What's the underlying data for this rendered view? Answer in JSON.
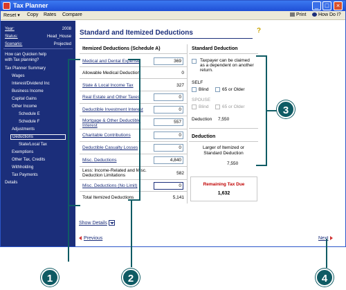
{
  "window": {
    "title": "Tax Planner",
    "minimize": "_",
    "maximize": "□",
    "close": "×"
  },
  "menu": {
    "reset": "Reset",
    "copy": "Copy",
    "rates": "Rates",
    "compare": "Compare",
    "print": "Print",
    "how_do_i": "How Do I?"
  },
  "sidebar": {
    "year_label": "Year:",
    "year_value": "2008",
    "status_label": "Status:",
    "status_value": "Head_House",
    "scenario_label": "Scenario:",
    "scenario_value": "Projected",
    "help_line1": "How can Quicken help",
    "help_line2": "with Tax planning?",
    "nav": [
      "Tax Planner Summary",
      "Wages",
      "Interest/Dividend Inc",
      "Business Income",
      "Capital Gains",
      "Other Income",
      "Schedule E",
      "Schedule F",
      "Adjustments",
      "Deductions",
      "State/Local Tax",
      "Exemptions",
      "Other Tax, Credits",
      "Withholding",
      "Tax Payments",
      "Details"
    ]
  },
  "main": {
    "title": "Standard and Itemized Deductions",
    "help_icon": "?",
    "itemized_heading": "Itemized Deductions (Schedule A)",
    "standard_heading": "Standard Deduction",
    "rows": [
      {
        "label": "Medical and Dental Expense",
        "value": "369"
      },
      {
        "label": "Allowable Medical Deduction",
        "value": "0"
      },
      {
        "label": "State & Local Income Tax",
        "value": "327"
      },
      {
        "label": "Real Estate and Other Taxes",
        "value": "0"
      },
      {
        "label": "Deductible Investment Interest",
        "value": "0"
      },
      {
        "label": "Mortgage & Other Deductible Interest",
        "value": "557"
      },
      {
        "label": "Charitable Contributions",
        "value": "0"
      },
      {
        "label": "Deductible Casualty Losses",
        "value": "0"
      },
      {
        "label": "Misc. Deductions",
        "value": "4,840"
      },
      {
        "label": "Less: Income-Related and Misc. Deduction Limitations",
        "value": "582"
      },
      {
        "label": "Misc. Deductions (No Limit)",
        "value": "0"
      },
      {
        "label": "Total Itemized Deductions",
        "value": "5,141"
      }
    ],
    "standard": {
      "dependent_text": "Taxpayer can be claimed as a dependent on another return.",
      "self_label": "SELF",
      "spouse_label": "SPOUSE",
      "blind": "Blind",
      "over65": "65 or Older",
      "deduction_label": "Deduction",
      "deduction_value": "7,550"
    },
    "deduction": {
      "heading": "Deduction",
      "larger_line1": "Larger of Itemized or",
      "larger_line2": "Standard Deduction",
      "value": "7,550"
    },
    "remaining": {
      "title": "Remaining Tax Due",
      "value": "1,632"
    },
    "show_details": "Show Details",
    "previous": "Previous",
    "next": "Next"
  },
  "callouts": [
    "1",
    "2",
    "3",
    "4"
  ],
  "colors": {
    "sidebar_bg": "#1b2e7a",
    "callout": "#0f5b64",
    "remaining_title": "#c00000"
  }
}
